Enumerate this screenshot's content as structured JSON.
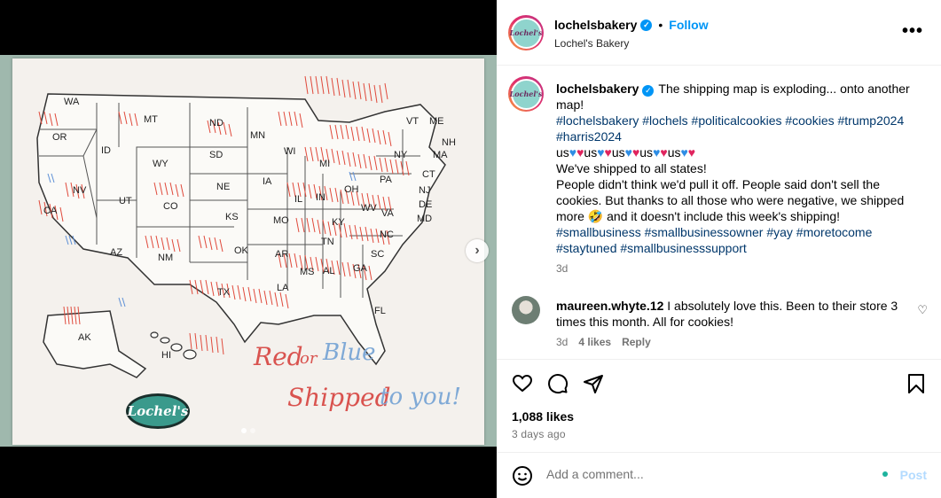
{
  "post": {
    "carousel": {
      "slide_count": 2,
      "active_slide": 1
    },
    "poster": {
      "states": [
        "WA",
        "OR",
        "CA",
        "NV",
        "ID",
        "MT",
        "WY",
        "UT",
        "AZ",
        "NM",
        "CO",
        "ND",
        "SD",
        "NE",
        "KS",
        "OK",
        "TX",
        "MN",
        "IA",
        "MO",
        "AR",
        "LA",
        "WI",
        "IL",
        "MI",
        "IN",
        "KY",
        "TN",
        "MS",
        "AL",
        "OH",
        "GA",
        "FL",
        "SC",
        "NC",
        "VA",
        "WV",
        "PA",
        "NY",
        "VT",
        "ME",
        "NH",
        "MA",
        "CT",
        "NJ",
        "DE",
        "MD",
        "AK",
        "HI"
      ],
      "handwriting_line1_red": "Red",
      "handwriting_line1_amp": "or",
      "handwriting_line1_blue": "Blue",
      "handwriting_line2_red": "Shipped",
      "handwriting_line2_blue": "to you!",
      "logo_text": "Lochel's"
    }
  },
  "header": {
    "username": "lochelsbakery",
    "separator": "•",
    "follow_label": "Follow",
    "subtitle": "Lochel's Bakery",
    "more_icon": "more-horizontal-icon"
  },
  "caption": {
    "username": "lochelsbakery",
    "line1": "The shipping map is exploding... onto another map!",
    "hashtags1": "#lochelsbakery #lochels #politicalcookies #cookies #trump2024 #harris2024",
    "us_text": "us",
    "line2": "We've shipped to all states!",
    "line3": "People didn't think we'd pull it off. People said don't sell the cookies. But thanks to all those who were negative, we shipped more",
    "line3_tail": "and it doesn't include this week's shipping!",
    "hashtags2": "#smallbusiness #smallbusinessowner #yay #moretocome #staytuned #smallbusinesssupport",
    "time": "3d"
  },
  "comment": {
    "username": "maureen.whyte.12",
    "text": "I absolutely love this. Been to their store 3 times this month. All for cookies!",
    "time": "3d",
    "likes": "4 likes",
    "reply": "Reply"
  },
  "actions": {
    "likes": "1,088 likes",
    "ago": "3 days ago"
  },
  "add_comment": {
    "placeholder": "Add a comment...",
    "post_label": "Post"
  }
}
